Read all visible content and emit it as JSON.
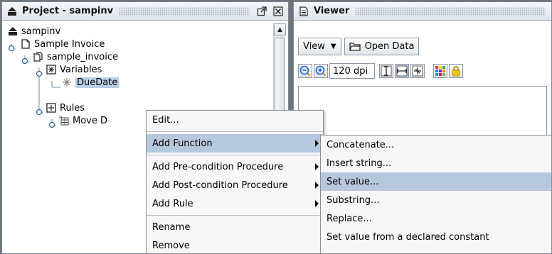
{
  "project_panel": {
    "title": "Project - sampinv",
    "tree": {
      "root": "sampinv",
      "invoice": "Sample Invoice",
      "invoice_node": "sample_invoice",
      "variables": "Variables",
      "due_date": "DueDate",
      "rules": "Rules",
      "move_rule": "Move D"
    }
  },
  "viewer_panel": {
    "title": "Viewer",
    "view_label": "View",
    "open_data_label": "Open Data",
    "dpi_value": "120 dpi"
  },
  "context_menu": {
    "items": [
      "Edit...",
      "Add Function",
      "Add Pre-condition Procedure",
      "Add Post-condition Procedure",
      "Add Rule",
      "Rename",
      "Remove"
    ]
  },
  "function_submenu": {
    "items": [
      "Concatenate...",
      "Insert string...",
      "Set value...",
      "Substring...",
      "Replace...",
      "Set value from a declared constant"
    ]
  },
  "colors": {
    "selection": "#b8cfe5",
    "menu_highlight": "#b6c8dd",
    "background": "#6d747c"
  }
}
